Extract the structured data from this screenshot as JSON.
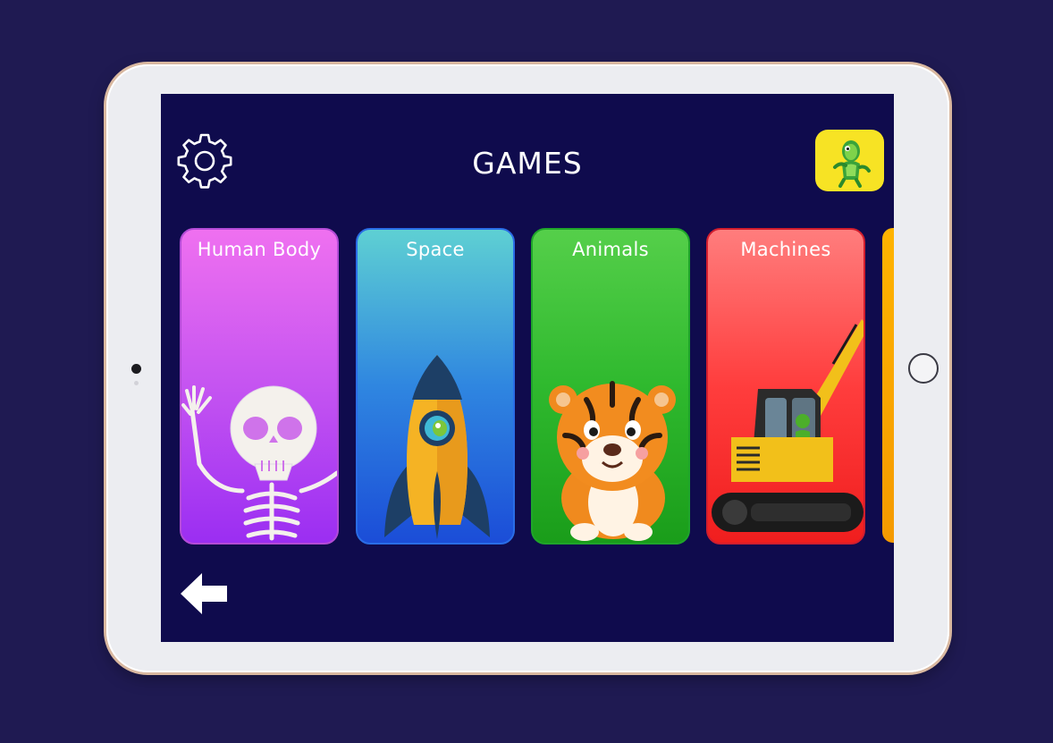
{
  "header": {
    "title": "GAMES",
    "settings_icon": "gear-icon",
    "profile_icon": "lizard-avatar-icon"
  },
  "categories": [
    {
      "label": "Human Body",
      "icon": "skeleton-icon",
      "color": "#c554f1"
    },
    {
      "label": "Space",
      "icon": "rocket-icon",
      "color": "#2f86e0"
    },
    {
      "label": "Animals",
      "icon": "tiger-icon",
      "color": "#2fb92e"
    },
    {
      "label": "Machines",
      "icon": "excavator-icon",
      "color": "#ff3d3d"
    }
  ],
  "footer": {
    "back_icon": "arrow-left-icon"
  },
  "theme": {
    "background": "#0f0b4d",
    "accent_yellow": "#f7e324"
  }
}
